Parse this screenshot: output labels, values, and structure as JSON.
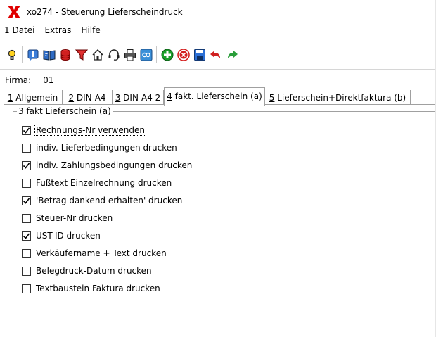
{
  "window": {
    "title": "xo274 - Steuerung Lieferscheindruck"
  },
  "menu": {
    "items": [
      {
        "acc": "1",
        "rest": " Datei"
      },
      {
        "acc": "",
        "rest": "Extras"
      },
      {
        "acc": "",
        "rest": "Hilfe"
      }
    ]
  },
  "toolbar": {
    "icons": [
      "lightbulb-icon",
      "info-icon",
      "book-icon",
      "database-icon",
      "filter-icon",
      "home-icon",
      "headset-icon",
      "printer-icon",
      "link-icon",
      "add-icon",
      "delete-icon",
      "save-icon",
      "undo-icon",
      "redo-icon"
    ]
  },
  "firma": {
    "label": "Firma:",
    "value": "01"
  },
  "tabs": [
    {
      "acc": "1",
      "rest": " Allgemein",
      "active": false
    },
    {
      "acc": "2",
      "rest": " DIN-A4",
      "active": false
    },
    {
      "acc": "3",
      "rest": " DIN-A4 2",
      "active": false
    },
    {
      "acc": "4",
      "rest": " fakt. Lieferschein (a)",
      "active": true
    },
    {
      "acc": "5",
      "rest": " Lieferschein+Direktfaktura (b)",
      "active": false
    }
  ],
  "group": {
    "title": "3 fakt Lieferschein (a)",
    "options": [
      {
        "label": "Rechnungs-Nr verwenden",
        "checked": true
      },
      {
        "label": "indiv. Lieferbedingungen drucken",
        "checked": false
      },
      {
        "label": "indiv. Zahlungsbedingungen drucken",
        "checked": true
      },
      {
        "label": "Fußtext Einzelrechnung drucken",
        "checked": false
      },
      {
        "label": "'Betrag dankend erhalten' drucken",
        "checked": true
      },
      {
        "label": "Steuer-Nr drucken",
        "checked": false
      },
      {
        "label": "UST-ID drucken",
        "checked": true
      },
      {
        "label": "Verkäufername + Text drucken",
        "checked": false
      },
      {
        "label": "Belegdruck-Datum drucken",
        "checked": false
      },
      {
        "label": "Textbaustein Faktura drucken",
        "checked": false
      }
    ]
  },
  "colors": {
    "logo_red": "#e00000",
    "add_green": "#1a9e2a",
    "delete_red": "#d42020",
    "save_blue": "#2b6fd6",
    "undo_red": "#d02020",
    "redo_green": "#2a9e3a"
  }
}
